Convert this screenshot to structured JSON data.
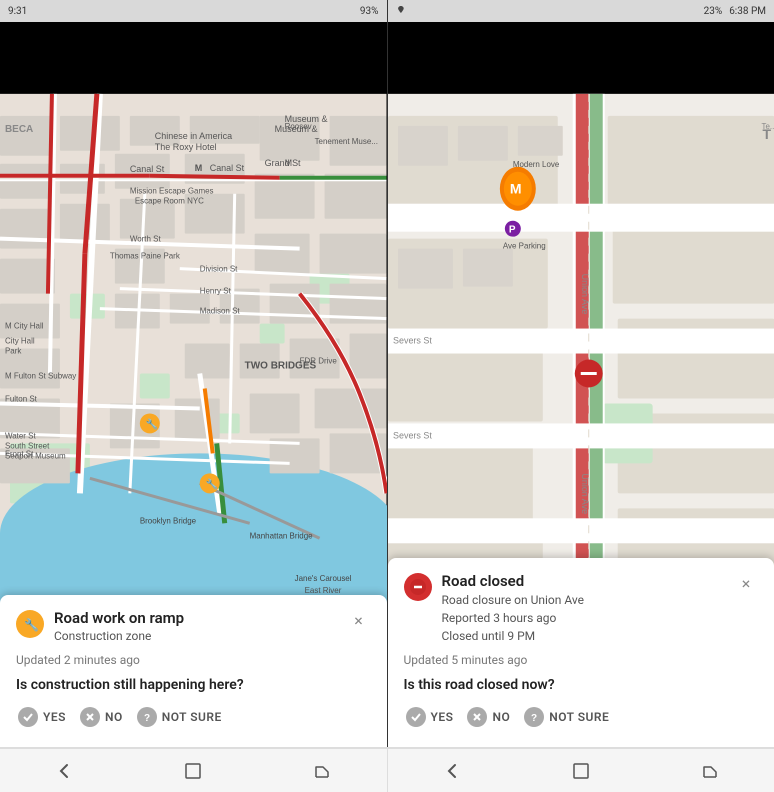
{
  "left_screen": {
    "status_bar": {
      "time": "9:31",
      "battery": "93%",
      "signal": "●●●"
    },
    "map_label": "NYC Map - Two Bridges Area",
    "card": {
      "icon_type": "yellow",
      "icon_label": "construction-icon",
      "title": "Road work on ramp",
      "subtitle": "Construction zone",
      "updated": "Updated 2 minutes ago",
      "question": "Is construction still happening here?",
      "actions": {
        "yes_label": "YES",
        "no_label": "NO",
        "not_sure_label": "NOT SURE"
      },
      "close_label": "×"
    }
  },
  "right_screen": {
    "status_bar": {
      "time": "6:38 PM",
      "battery": "23%",
      "signal": "●●●"
    },
    "map_label": "Zoomed map - Union Ave",
    "card": {
      "icon_type": "red",
      "icon_label": "road-closed-icon",
      "title": "Road closed",
      "subtitle": "Road closure on Union Ave\nReported 3 hours ago\nClosed until 9 PM",
      "updated": "Updated 5 minutes ago",
      "question": "Is this road closed now?",
      "actions": {
        "yes_label": "YES",
        "no_label": "NO",
        "not_sure_label": "NOT SURE"
      },
      "close_label": "×"
    }
  },
  "nav_bar": {
    "back_icon": "←",
    "home_icon": "□",
    "recent_icon": "⌐"
  },
  "colors": {
    "road_red": "#c62828",
    "road_yellow": "#f9a825",
    "road_green": "#388e3c",
    "water": "#80c8e0",
    "park": "#c8e6c9",
    "building": "#e0dbd4",
    "card_bg": "#ffffff",
    "action_icon": "#9e9e9e"
  }
}
